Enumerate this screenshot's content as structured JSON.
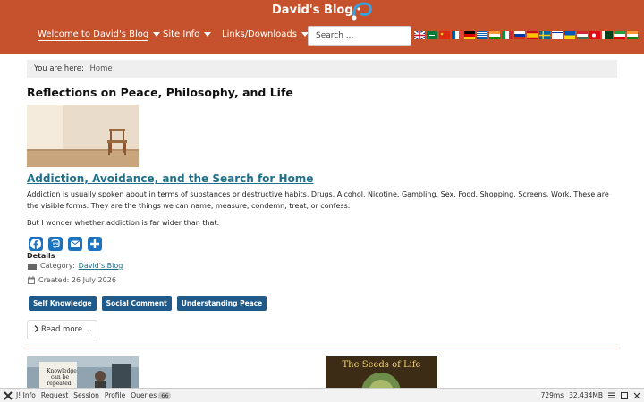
{
  "header": {
    "site_title": "David's Blog",
    "nav": [
      {
        "label": "Welcome to David's Blog"
      },
      {
        "label": "Site Info"
      },
      {
        "label": "Links/Downloads"
      }
    ],
    "search_placeholder": "Search ...",
    "flag_icons": [
      "uk-flag-icon",
      "saudi-flag-icon",
      "china-flag-icon",
      "france-flag-icon",
      "germany-flag-icon",
      "greece-flag-icon",
      "india-flag-icon",
      "italy-flag-icon",
      "russia-flag-icon",
      "spain-flag-icon",
      "sweden-flag-icon",
      "israel-flag-icon",
      "ukraine-flag-icon",
      "hungary-flag-icon",
      "turkey-flag-icon",
      "pakistan-flag-icon",
      "iran-flag-icon",
      "india-flag-icon"
    ]
  },
  "breadcrumb": {
    "prefix": "You are here:",
    "home": "Home"
  },
  "page": {
    "heading": "Reflections on Peace, Philosophy, and Life"
  },
  "article": {
    "title": "Addiction, Avoidance, and the Search for Home",
    "paragraph1": "Addiction is usually spoken about in terms of substances or destructive habits. Drugs. Alcohol. Nicotine. Gambling. Sex. Food. Shopping. Screens. Work. These are the visible forms. They are the things we can name, measure, condemn, treat, or confess.",
    "paragraph2": "But I wonder whether addiction is far wider than that.",
    "share_icons": [
      "facebook-icon",
      "mastodon-icon",
      "email-icon",
      "share-icon"
    ],
    "details_label": "Details",
    "category_label": "Category:",
    "category_value": "David's Blog",
    "created": "Created: 26 July 2026",
    "tags": [
      "Self Knowledge",
      "Social Comment",
      "Understanding Peace"
    ],
    "read_more": "Read more ..."
  },
  "thumbs": {
    "thumb1_text": "Knowledge can be repeated.",
    "thumb2_text": "The Seeds of Life"
  },
  "debugbar": {
    "items": [
      "Info",
      "Request",
      "Session",
      "Profile",
      "Queries"
    ],
    "queries_count": "66",
    "time": "729ms",
    "memory": "32.434MB"
  },
  "colors": {
    "header_bg": "#c5522c",
    "link": "#1f6f8b",
    "tag_bg": "#205a8a"
  }
}
